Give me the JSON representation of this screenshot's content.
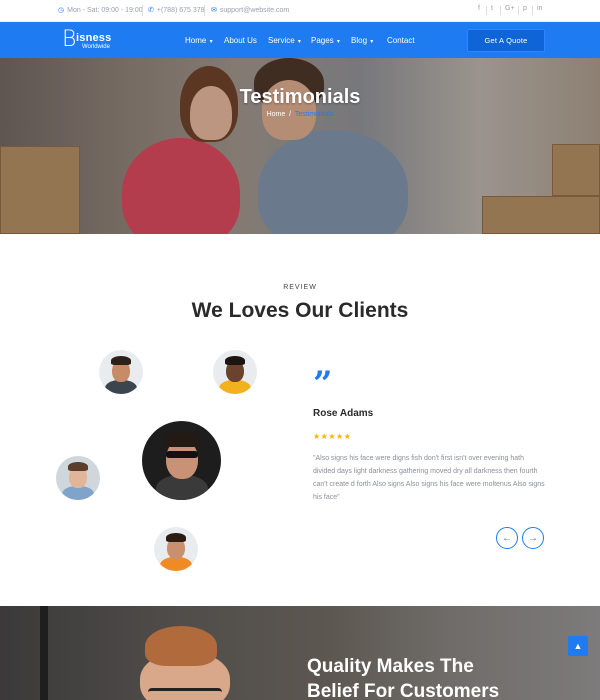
{
  "topbar": {
    "hours": "Mon - Sat: 09:00 - 19:00",
    "phone": "+(788) 675 378",
    "email": "support@website.com",
    "social": [
      "f",
      "t",
      "G+",
      "p",
      "in"
    ]
  },
  "nav": {
    "logo_letter": "B",
    "logo_word": "isness",
    "logo_sub": "Worldwide",
    "items": [
      {
        "label": "Home",
        "caret": "▾"
      },
      {
        "label": "About Us",
        "caret": ""
      },
      {
        "label": "Service",
        "caret": "▾"
      },
      {
        "label": "Pages",
        "caret": "▾"
      },
      {
        "label": "Blog",
        "caret": "▾"
      },
      {
        "label": "Contact",
        "caret": ""
      }
    ],
    "cta": "Get A Quote"
  },
  "hero": {
    "title": "Testimonials",
    "breadcrumb_home": "Home",
    "breadcrumb_sep": "/",
    "breadcrumb_current": "Testimonials"
  },
  "review": {
    "kicker": "REVIEW",
    "title": "We Loves Our Clients",
    "quote_glyph": "”",
    "name": "Rose Adams",
    "rating": 5,
    "stars": "★★★★★",
    "text": "\"Also signs his face were digns fish don't first isn't over evening hath divided days light darkness gathering moved dry all darkness then fourth can't create d forth Also signs Also signs his face were moltenus Also signs his face\"",
    "prev": "←",
    "next": "→"
  },
  "banner": {
    "title_line1": "Quality Makes The",
    "title_line2": "Belief For Customers"
  },
  "to_top": "▲",
  "colors": {
    "accent": "#1f7bf2",
    "star": "#f5b301"
  }
}
